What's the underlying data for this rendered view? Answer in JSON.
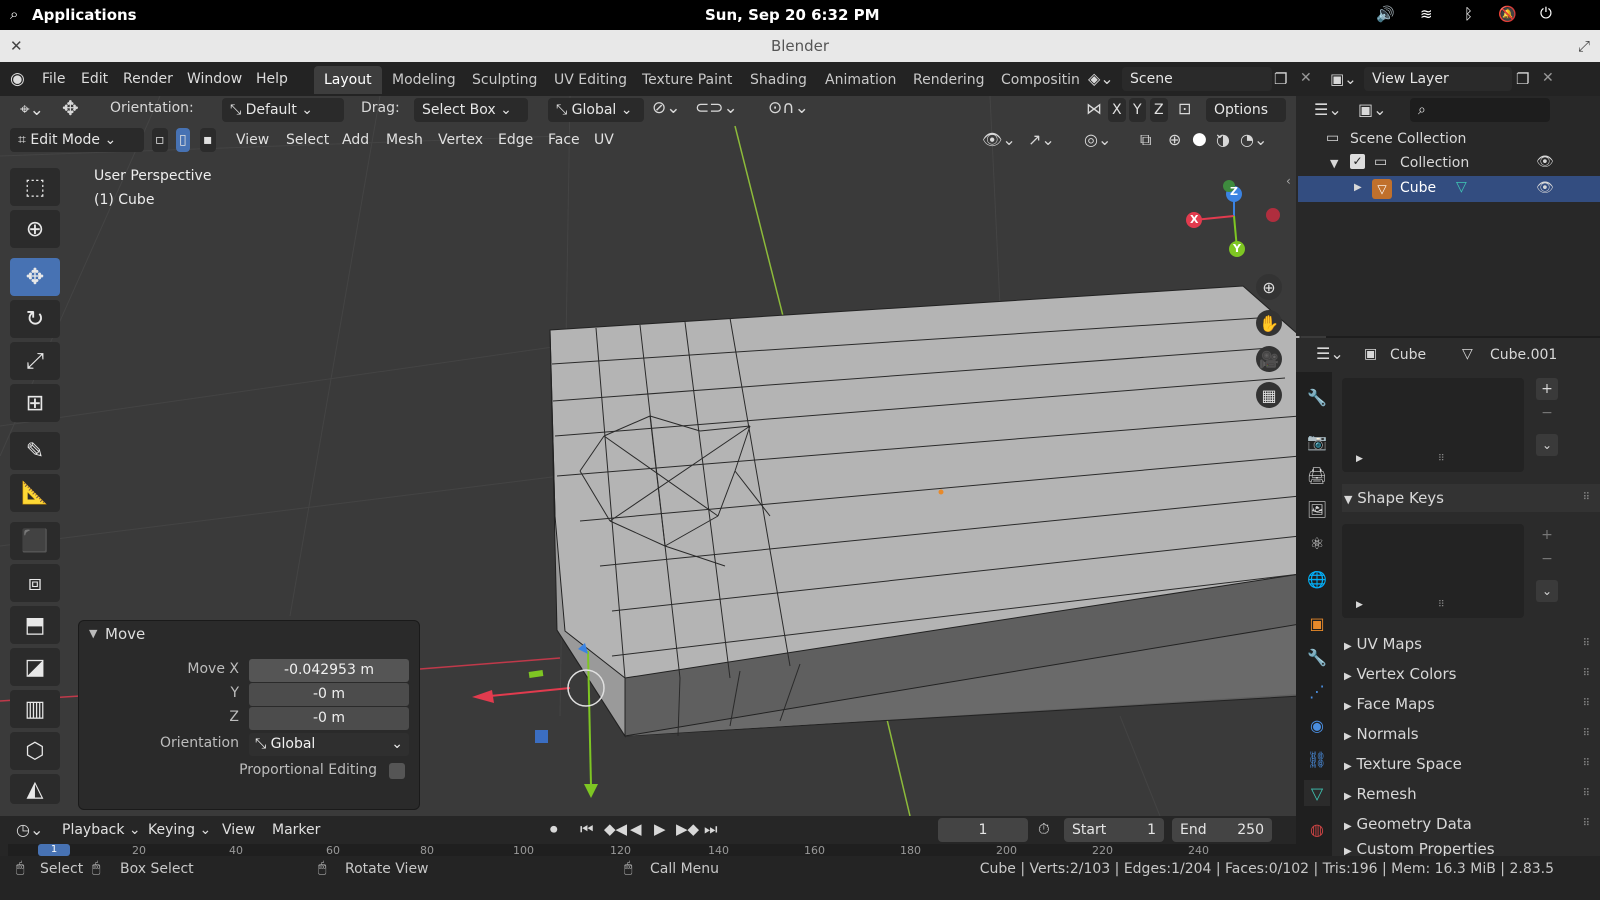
{
  "system": {
    "applications": "Applications",
    "datetime": "Sun, Sep 20   6:32 PM"
  },
  "window": {
    "title": "Blender"
  },
  "menu": {
    "file": "File",
    "edit": "Edit",
    "render": "Render",
    "window": "Window",
    "help": "Help"
  },
  "workspaces": [
    "Layout",
    "Modeling",
    "Sculpting",
    "UV Editing",
    "Texture Paint",
    "Shading",
    "Animation",
    "Rendering",
    "Compositin"
  ],
  "scene": {
    "name": "Scene",
    "view_layer": "View Layer"
  },
  "header": {
    "orientation_label": "Orientation:",
    "orientation_value": "Default",
    "drag_label": "Drag:",
    "drag_value": "Select Box",
    "transform_value": "Global",
    "options": "Options",
    "axis_x": "X",
    "axis_y": "Y",
    "axis_z": "Z"
  },
  "editbar": {
    "mode": "Edit Mode",
    "view": "View",
    "select": "Select",
    "add": "Add",
    "mesh": "Mesh",
    "vertex": "Vertex",
    "edge": "Edge",
    "face": "Face",
    "uv": "UV"
  },
  "viewport": {
    "perspective": "User Perspective",
    "object": "(1) Cube",
    "gizmo_x": "X",
    "gizmo_y": "Y",
    "gizmo_z": "Z"
  },
  "move_panel": {
    "title": "Move",
    "move_x_label": "Move X",
    "move_x": "-0.042953 m",
    "y_label": "Y",
    "y": "-0 m",
    "z_label": "Z",
    "z": "-0 m",
    "orientation_label": "Orientation",
    "orientation": "Global",
    "proportional": "Proportional Editing"
  },
  "timeline": {
    "playback": "Playback",
    "keying": "Keying",
    "view": "View",
    "marker": "Marker",
    "frame": "1",
    "start_label": "Start",
    "start": "1",
    "end_label": "End",
    "end": "250",
    "ruler": [
      "20",
      "40",
      "60",
      "80",
      "100",
      "120",
      "140",
      "160",
      "180",
      "200",
      "220",
      "240"
    ],
    "current_marker": "1"
  },
  "outliner": {
    "scene_collection": "Scene Collection",
    "collection": "Collection",
    "cube": "Cube"
  },
  "properties": {
    "object": "Cube",
    "mesh": "Cube.001",
    "sections": [
      "Shape Keys",
      "UV Maps",
      "Vertex Colors",
      "Face Maps",
      "Normals",
      "Texture Space",
      "Remesh",
      "Geometry Data",
      "Custom Properties"
    ]
  },
  "status": {
    "select": "Select",
    "box_select": "Box Select",
    "rotate_view": "Rotate View",
    "call_menu": "Call Menu",
    "stats": "Cube | Verts:2/103 | Edges:1/204 | Faces:0/102 | Tris:196 | Mem: 16.3 MiB | 2.83.5"
  },
  "colors": {
    "accent": "#4772b3",
    "x_axis": "#e23b4e",
    "y_axis": "#7ec623",
    "z_axis": "#3b83e2"
  }
}
